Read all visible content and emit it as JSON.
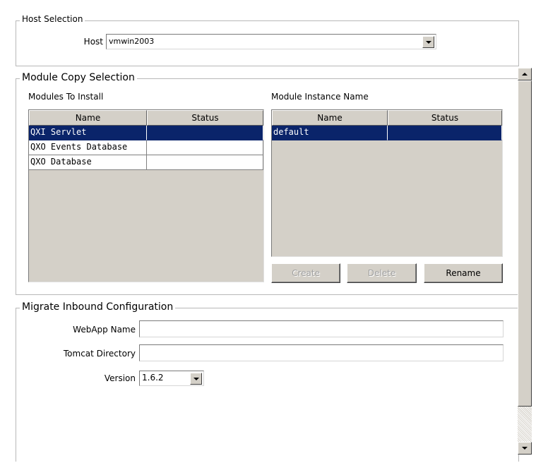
{
  "host_selection": {
    "legend": "Host Selection",
    "host_label": "Host",
    "host_value": "vmwin2003"
  },
  "module_copy": {
    "legend": "Module Copy Selection",
    "modules_label": "Modules To Install",
    "instance_label": "Module Instance Name",
    "modules_table": {
      "headers": [
        "Name",
        "Status"
      ],
      "rows": [
        {
          "name": "QXI Servlet",
          "status": "",
          "selected": true
        },
        {
          "name": "QXO Events Database",
          "status": "",
          "selected": false
        },
        {
          "name": "QXO Database",
          "status": "",
          "selected": false
        }
      ]
    },
    "instance_table": {
      "headers": [
        "Name",
        "Status"
      ],
      "rows": [
        {
          "name": "default",
          "status": "",
          "selected": true
        }
      ]
    },
    "buttons": {
      "create": "Create",
      "delete": "Delete",
      "rename": "Rename"
    }
  },
  "migrate_inbound": {
    "legend": "Migrate Inbound Configuration",
    "webapp_label": "WebApp Name",
    "webapp_value": "",
    "tomcat_label": "Tomcat Directory",
    "tomcat_value": "",
    "version_label": "Version",
    "version_value": "1.6.2"
  },
  "colors": {
    "selection": "#0a246a",
    "control_face": "#d4d0c8"
  },
  "icons": [
    "chevron-down-icon",
    "scroll-up-icon",
    "scroll-down-icon"
  ]
}
